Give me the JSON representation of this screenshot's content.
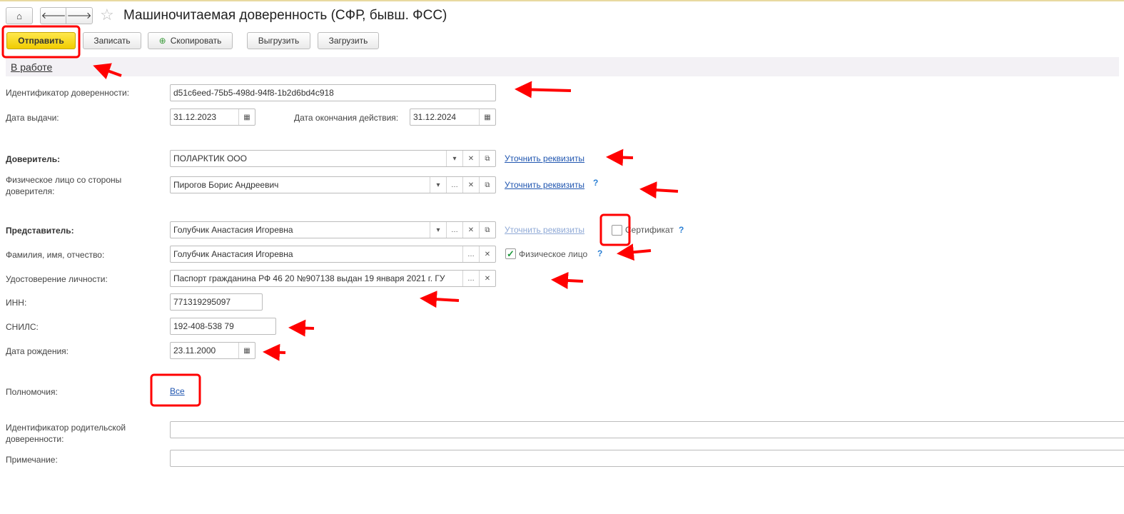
{
  "header": {
    "title": "Машиночитаемая доверенность (СФР, бывш. ФСС)"
  },
  "toolbar": {
    "send": "Отправить",
    "save": "Записать",
    "copy": "Скопировать",
    "export": "Выгрузить",
    "import": "Загрузить"
  },
  "status": "В работе",
  "fields": {
    "id_label": "Идентификатор доверенности:",
    "id_value": "d51c6eed-75b5-498d-94f8-1b2d6bd4c918",
    "issue_label": "Дата выдачи:",
    "issue_value": "31.12.2023",
    "end_label": "Дата окончания действия:",
    "end_value": "31.12.2024",
    "principal_label": "Доверитель:",
    "principal_value": "ПОЛАРКТИК ООО",
    "principal_person_label": "Физическое лицо со стороны доверителя:",
    "principal_person_value": "Пирогов Борис Андреевич",
    "representative_label": "Представитель:",
    "representative_value": "Голубчик Анастасия Игоревна",
    "fio_label": "Фамилия, имя, отчество:",
    "fio_value": "Голубчик Анастасия Игоревна",
    "id_doc_label": "Удостоверение личности:",
    "id_doc_value": "Паспорт гражданина РФ 46 20 №907138 выдан 19 января 2021 г. ГУ",
    "inn_label": "ИНН:",
    "inn_value": "771319295097",
    "snils_label": "СНИЛС:",
    "snils_value": "192-408-538 79",
    "birth_label": "Дата рождения:",
    "birth_value": "23.11.2000",
    "powers_label": "Полномочия:",
    "powers_value": "Все",
    "parent_label": "Идентификатор родительской доверенности:",
    "parent_value": "",
    "note_label": "Примечание:",
    "note_value": ""
  },
  "links": {
    "refine": "Уточнить реквизиты",
    "help": "?"
  },
  "checkboxes": {
    "certificate": "Сертификат",
    "certificate_checked": false,
    "individual": "Физическое лицо",
    "individual_checked": true
  },
  "colors": {
    "primary": "#f5d300",
    "link": "#2056b0",
    "annotation": "#ff0000"
  }
}
